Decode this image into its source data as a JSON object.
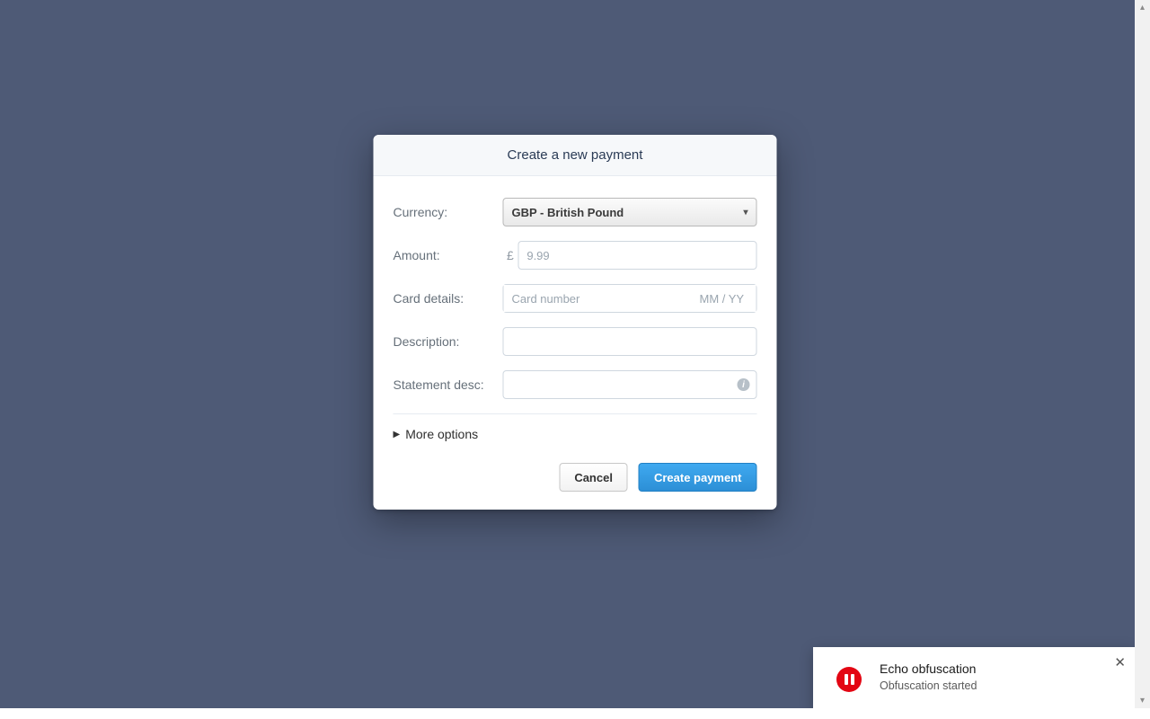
{
  "modal": {
    "title": "Create a new payment",
    "fields": {
      "currency": {
        "label": "Currency:",
        "value": "GBP - British Pound"
      },
      "amount": {
        "label": "Amount:",
        "symbol": "£",
        "placeholder": "9.99"
      },
      "card": {
        "label": "Card details:",
        "number_placeholder": "Card number",
        "exp_placeholder": "MM / YY"
      },
      "description": {
        "label": "Description:"
      },
      "statement": {
        "label": "Statement desc:"
      }
    },
    "more_options": "More options",
    "buttons": {
      "cancel": "Cancel",
      "submit": "Create payment"
    }
  },
  "toast": {
    "icon": "pause-icon",
    "title": "Echo obfuscation",
    "message": "Obfuscation started"
  }
}
